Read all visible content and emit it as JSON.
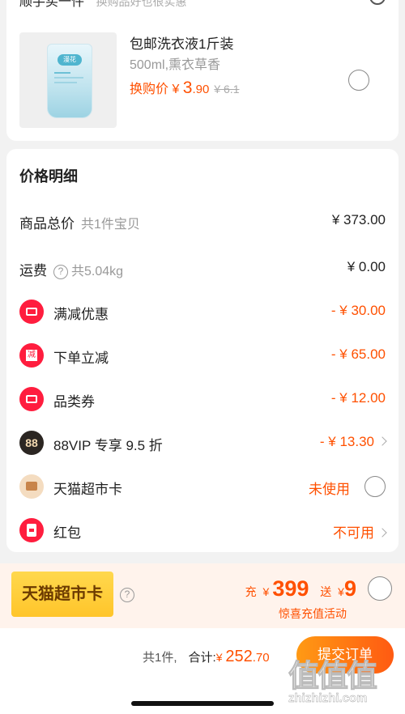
{
  "top_section": {
    "header": "顺手买一件",
    "header_sub": "换购品好也很实惠"
  },
  "product": {
    "title": "包邮洗衣液1斤装",
    "spec": "500ml,熏衣草香",
    "price_prefix": "换购价 ¥ ",
    "price_int": "3",
    "price_cents": ".90",
    "original_price": "¥ 6.1",
    "bag_logo": "漫花"
  },
  "price_detail": {
    "title": "价格明细",
    "rows": [
      {
        "label": "商品总价",
        "sub": "共1件宝贝",
        "value": "¥ 373.00"
      },
      {
        "label": "运费",
        "sub": "共5.04kg",
        "value": "¥ 0.00"
      },
      {
        "label": "满减优惠",
        "value": "- ¥ 30.00"
      },
      {
        "label": "下单立减",
        "value": "- ¥ 65.00"
      },
      {
        "label": "品类券",
        "value": "- ¥ 12.00"
      },
      {
        "label": "88VIP 专享 9.5 折",
        "value": "- ¥ 13.30"
      },
      {
        "label": "天猫超市卡",
        "value": "未使用"
      },
      {
        "label": "红包",
        "value": "不可用"
      }
    ],
    "icons": {
      "discount": "ticket-icon",
      "instant": "reduce-badge-icon",
      "category": "ticket-icon",
      "vip": "88",
      "card": "card-icon",
      "redpacket": "red-envelope-icon"
    }
  },
  "promo": {
    "badge": "天猫超市卡",
    "recharge_label": "充",
    "recharge_yen": "¥",
    "recharge_amount": "399",
    "gift_label": "送",
    "gift_yen": "¥",
    "gift_amount": "9",
    "note": "惊喜充值活动"
  },
  "footer": {
    "count": "共1件,",
    "total_label": "合计:",
    "yen": "¥ ",
    "total_int": "252",
    "total_cents": ".70",
    "submit": "提交订单"
  },
  "watermark": {
    "glyphs": "值值值",
    "url": "zhizhizhi.com"
  },
  "colors": {
    "accent": "#ff5000",
    "icon_red": "#ff1d3e",
    "button_start": "#ff9a14",
    "button_end": "#ff5a12",
    "promo_bg": "#fff3ec",
    "badge_gold": "#ffc52a"
  }
}
